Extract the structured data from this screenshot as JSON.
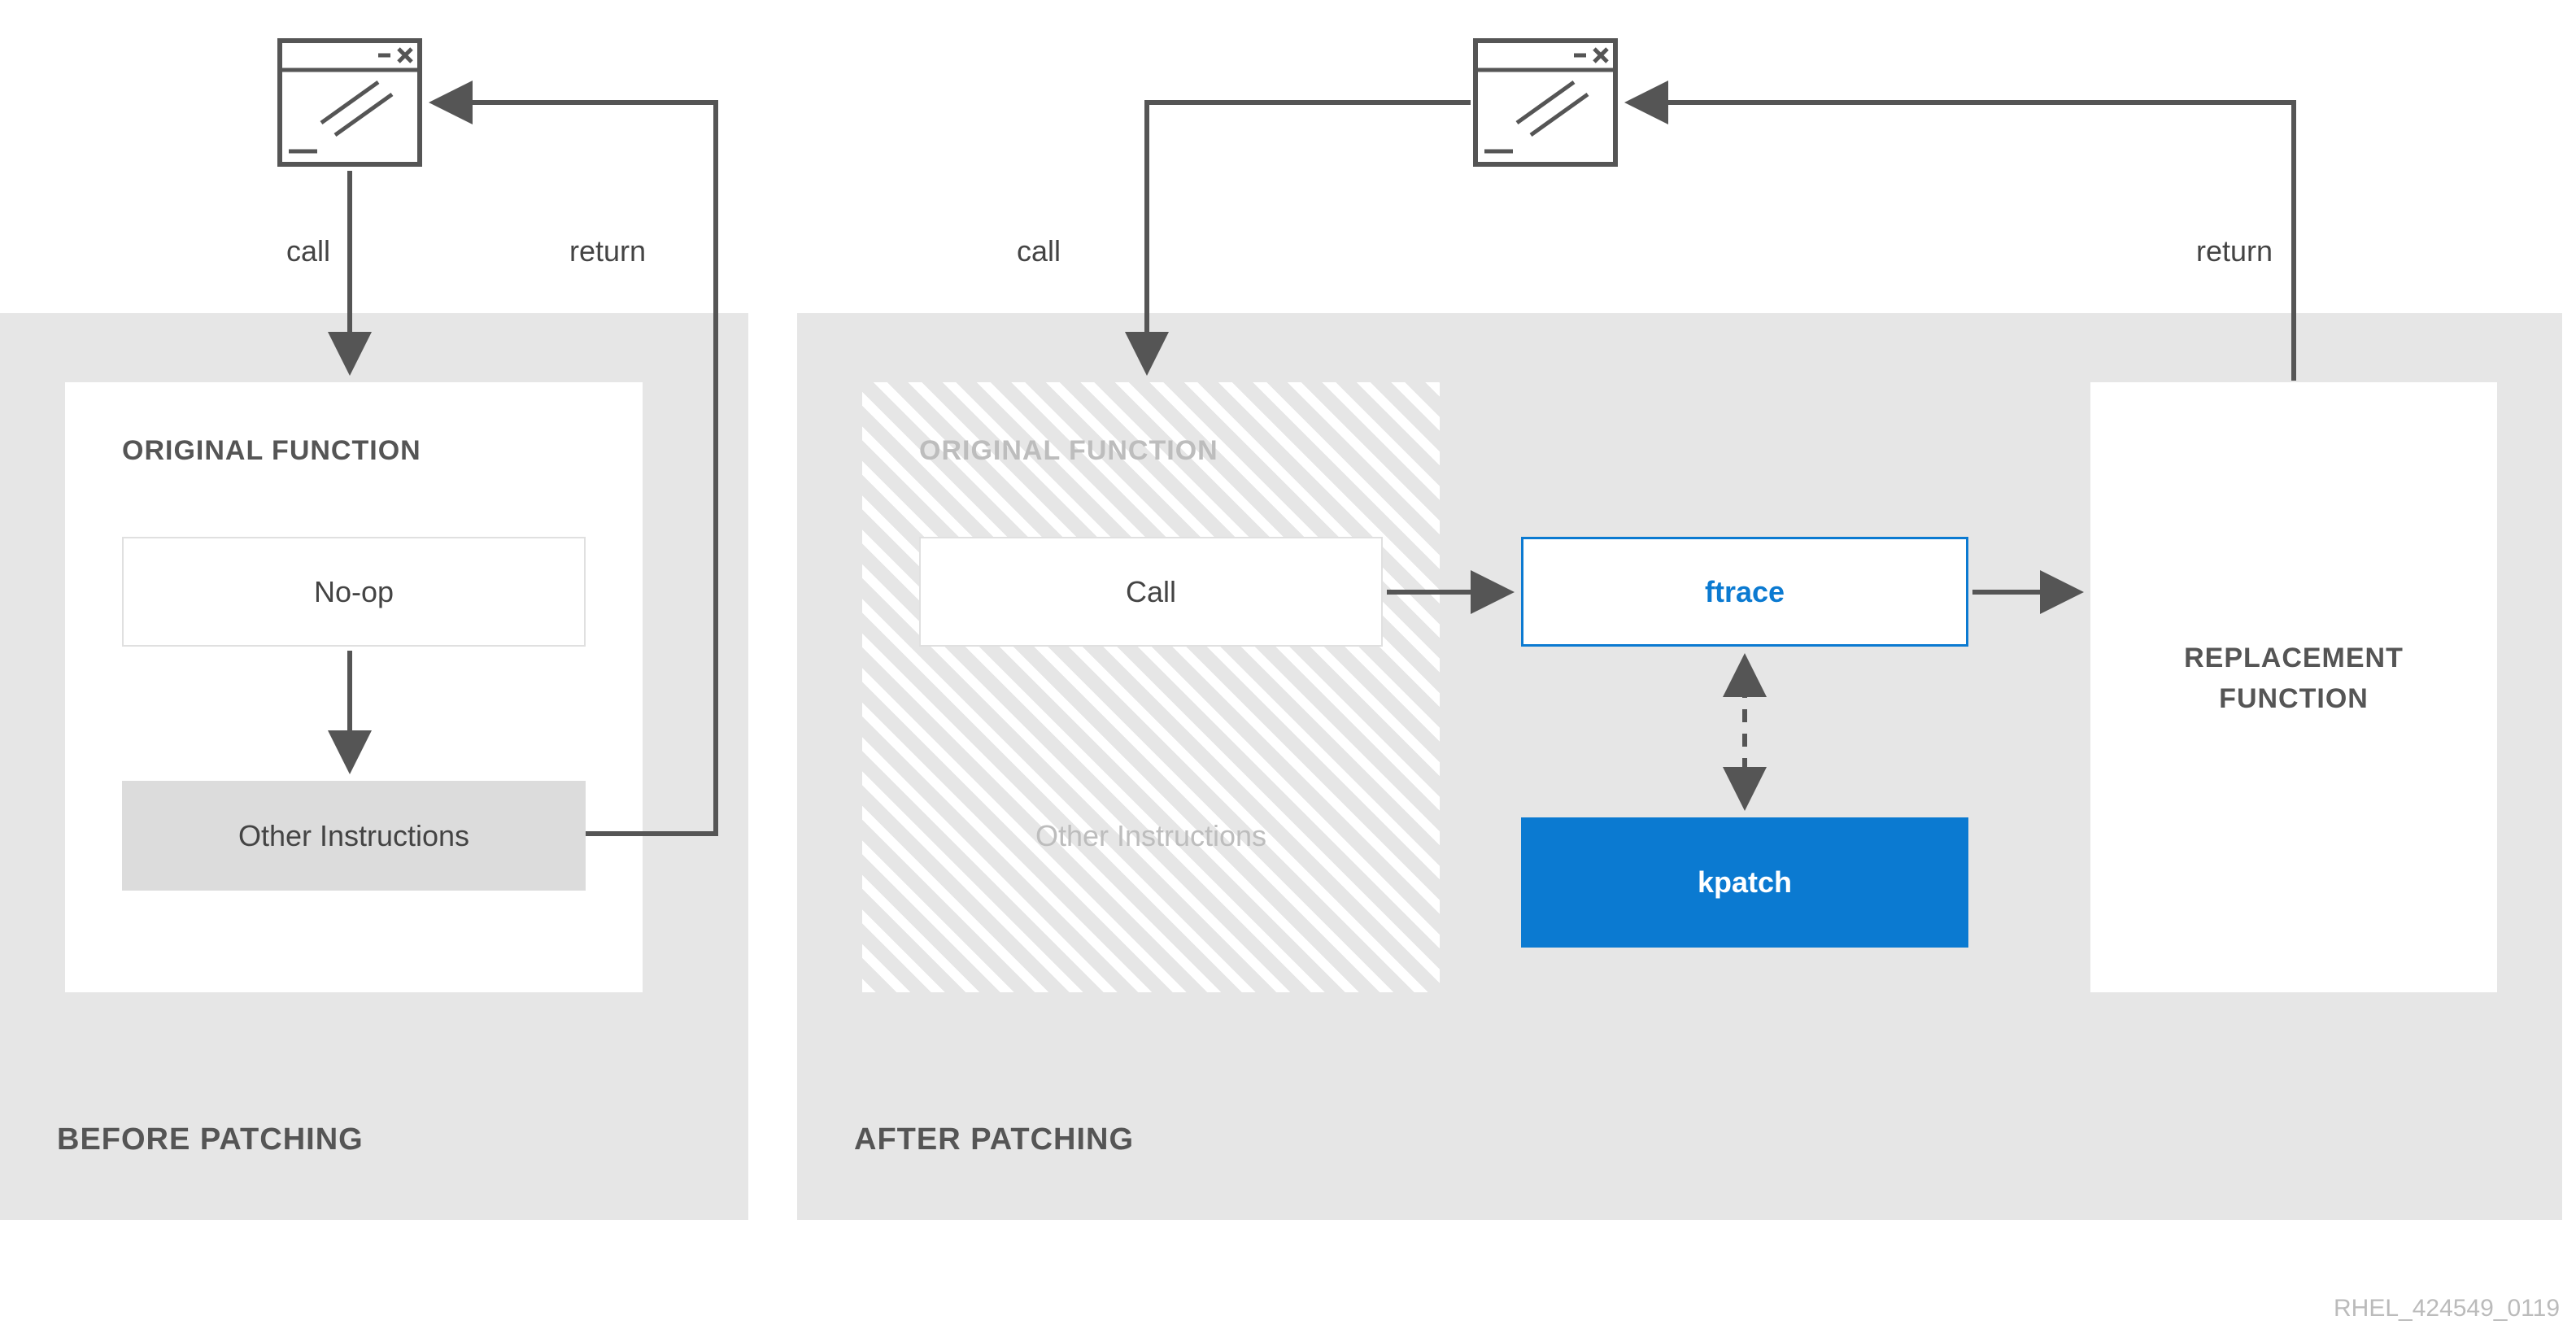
{
  "footer": "RHEL_424549_0119",
  "labels": {
    "call": "call",
    "return": "return"
  },
  "before": {
    "title": "BEFORE PATCHING",
    "original_function": "ORIGINAL FUNCTION",
    "noop": "No-op",
    "other": "Other Instructions"
  },
  "after": {
    "title": "AFTER PATCHING",
    "original_function": "ORIGINAL FUNCTION",
    "call": "Call",
    "other": "Other Instructions",
    "ftrace": "ftrace",
    "kpatch": "kpatch",
    "replacement1": "REPLACEMENT",
    "replacement2": "FUNCTION"
  },
  "colors": {
    "accent": "#0b7ad1",
    "panel": "#e6e6e6",
    "text": "#555"
  }
}
